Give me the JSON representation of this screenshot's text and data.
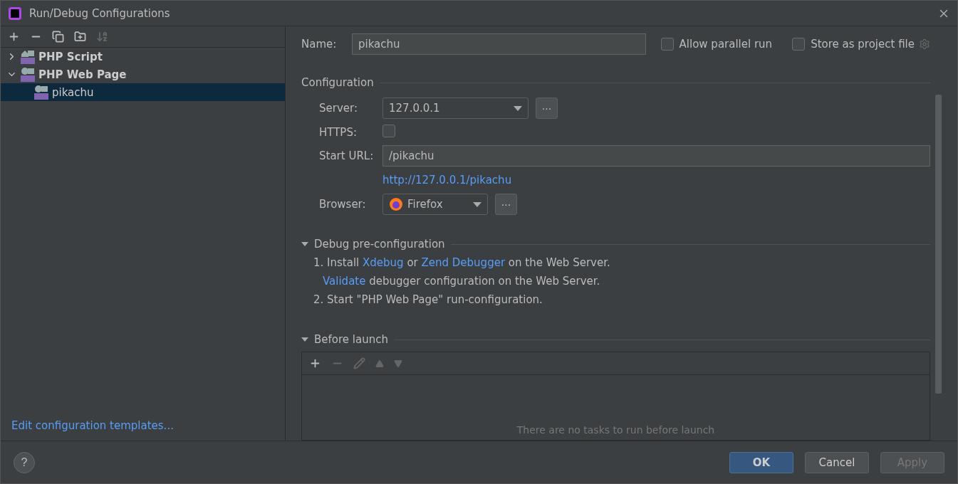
{
  "window": {
    "title": "Run/Debug Configurations"
  },
  "toolbar": [
    {
      "kind": "add",
      "disabled": false
    },
    {
      "kind": "remove",
      "disabled": false
    },
    {
      "kind": "copy",
      "disabled": false
    },
    {
      "kind": "folder",
      "disabled": false
    },
    {
      "kind": "sort",
      "disabled": true
    }
  ],
  "tree": [
    {
      "label": "PHP Script",
      "kind": "script",
      "expanded": false,
      "selected": false
    },
    {
      "label": "PHP Web Page",
      "kind": "web",
      "expanded": true,
      "selected": false,
      "children": [
        {
          "label": "pikachu",
          "kind": "web",
          "selected": true
        }
      ]
    }
  ],
  "templates_link": "Edit configuration templates...",
  "name": {
    "label": "Name:",
    "value": "pikachu"
  },
  "options": [
    {
      "label": "Allow parallel run",
      "checked": false
    },
    {
      "label": "Store as project file",
      "checked": false
    }
  ],
  "configuration": {
    "title": "Configuration",
    "server": {
      "label": "Server:",
      "value": "127.0.0.1",
      "more": "..."
    },
    "https": {
      "label": "HTTPS:",
      "checked": false
    },
    "start_url": {
      "label": "Start URL:",
      "value": "/pikachu"
    },
    "resolved_url": "http://127.0.0.1/pikachu",
    "browser": {
      "label": "Browser:",
      "value": "Firefox",
      "more": "..."
    }
  },
  "debug": {
    "title": "Debug pre-configuration",
    "expanded": true,
    "lines": [
      [
        {
          "kind": "text",
          "text": "1. Install"
        },
        {
          "kind": "link",
          "text": "Xdebug"
        },
        {
          "kind": "text",
          "text": "or"
        },
        {
          "kind": "link",
          "text": "Zend Debugger"
        },
        {
          "kind": "text",
          "text": "on the Web Server."
        }
      ],
      [
        {
          "kind": "link",
          "text": "Validate"
        },
        {
          "kind": "text",
          "text": "debugger configuration on the Web Server."
        }
      ],
      [
        {
          "kind": "text",
          "text": "2. Start \"PHP Web Page\" run-configuration."
        }
      ]
    ]
  },
  "before_launch": {
    "title": "Before launch",
    "expanded": true,
    "tools": [
      {
        "kind": "add",
        "disabled": false
      },
      {
        "kind": "remove",
        "disabled": true
      },
      {
        "kind": "edit",
        "disabled": true
      },
      {
        "kind": "up",
        "disabled": true
      },
      {
        "kind": "down",
        "disabled": true
      }
    ],
    "empty_text": "There are no tasks to run before launch"
  },
  "buttons": [
    {
      "label": "OK",
      "kind": "primary",
      "disabled": false
    },
    {
      "label": "Cancel",
      "kind": "normal",
      "disabled": false
    },
    {
      "label": "Apply",
      "kind": "normal",
      "disabled": true
    }
  ],
  "help": "?"
}
